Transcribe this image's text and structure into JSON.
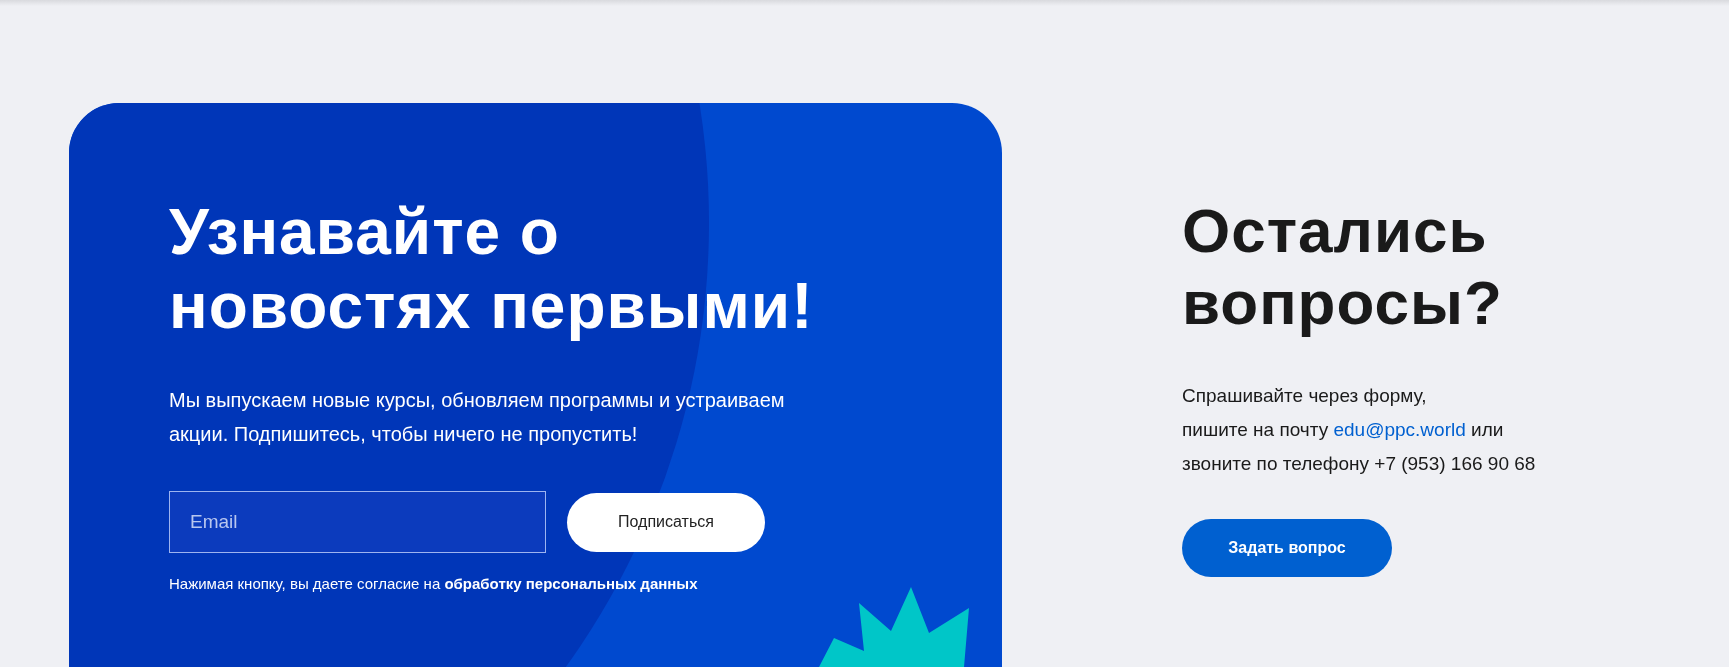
{
  "subscribe": {
    "title": "Узнавайте о новостях первыми!",
    "text": "Мы выпускаем новые курсы, обновляем программы и устраиваем акции. Подпишитесь, чтобы ничего не пропустить!",
    "email_field": {
      "placeholder": "Email"
    },
    "button": "Подписаться",
    "consent": "Нажимая кнопку, вы даете согласие на",
    "consent_link": "обработку персональных данных"
  },
  "questions": {
    "title": "Остались вопросы?",
    "line_1": "Спрашивайте через форму,",
    "before_link": "пишите на почту",
    "email": "edu@ppc.world",
    "after_link": "или",
    "line_3": "звоните по телефону +7 (953) 166 90 68",
    "button": "Задать вопрос"
  }
}
